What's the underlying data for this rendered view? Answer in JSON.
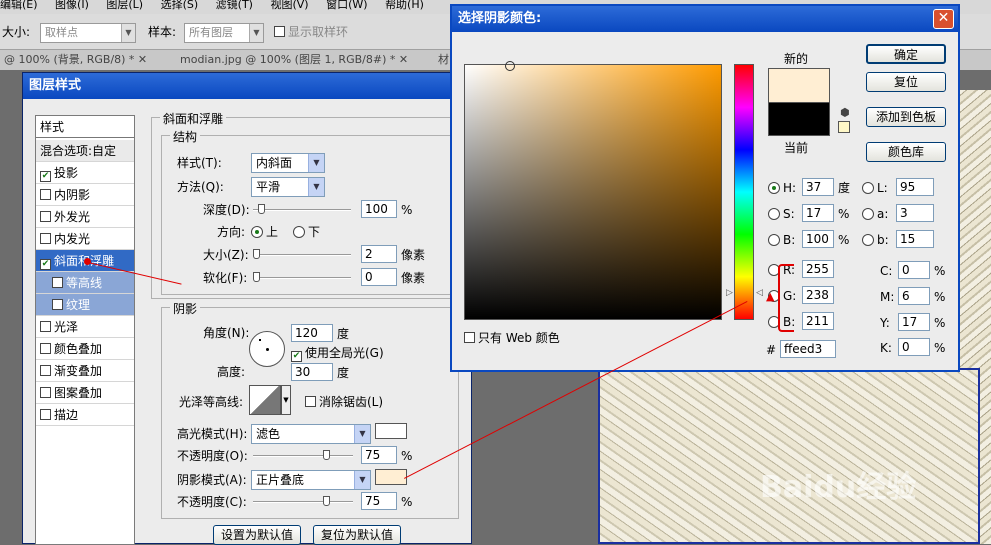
{
  "menubar": {
    "items": [
      "编辑(E)",
      "图像(I)",
      "图层(L)",
      "选择(S)",
      "滤镜(T)",
      "视图(V)",
      "窗口(W)",
      "帮助(H)"
    ]
  },
  "options_bar": {
    "size_label": "大小:",
    "size_value": "取样点",
    "sample_label": "样本:",
    "sample_value": "所有图层",
    "show_ring_label": "显示取样环"
  },
  "document_tabs": [
    {
      "label": "@ 100% (背景, RGB/8) * ✕"
    },
    {
      "label": "modian.jpg @ 100% (图层 1, RGB/8#) * ✕"
    },
    {
      "label": "材"
    }
  ],
  "layer_style": {
    "title": "图层样式",
    "styles_header": "样式",
    "blend_options": "混合选项:自定",
    "items": [
      {
        "label": "投影",
        "checked": true
      },
      {
        "label": "内阴影",
        "checked": false
      },
      {
        "label": "外发光",
        "checked": false
      },
      {
        "label": "内发光",
        "checked": false
      },
      {
        "label": "斜面和浮雕",
        "checked": true,
        "selected": true
      },
      {
        "label": "等高线",
        "checked": false,
        "sub": true
      },
      {
        "label": "纹理",
        "checked": false,
        "sub": true
      },
      {
        "label": "光泽",
        "checked": false
      },
      {
        "label": "颜色叠加",
        "checked": false
      },
      {
        "label": "渐变叠加",
        "checked": false
      },
      {
        "label": "图案叠加",
        "checked": false
      },
      {
        "label": "描边",
        "checked": false
      }
    ],
    "bevel_title": "斜面和浮雕",
    "structure_title": "结构",
    "style_label": "样式(T):",
    "style_value": "内斜面",
    "method_label": "方法(Q):",
    "method_value": "平滑",
    "depth_label": "深度(D):",
    "depth_value": "100",
    "depth_unit": "%",
    "direction_label": "方向:",
    "dir_up": "上",
    "dir_down": "下",
    "size_label": "大小(Z):",
    "size_value": "2",
    "size_unit": "像素",
    "soften_label": "软化(F):",
    "soften_value": "0",
    "soften_unit": "像素",
    "shading_title": "阴影",
    "angle_label": "角度(N):",
    "angle_value": "120",
    "angle_unit": "度",
    "global_light_label": "使用全局光(G)",
    "altitude_label": "高度:",
    "altitude_value": "30",
    "altitude_unit": "度",
    "gloss_label": "光泽等高线:",
    "antialias_label": "消除锯齿(L)",
    "highlight_mode_label": "高光模式(H):",
    "highlight_mode_value": "滤色",
    "highlight_color": "#ffffff",
    "opacity1_label": "不透明度(O):",
    "opacity1_value": "75",
    "opacity_unit": "%",
    "shadow_mode_label": "阴影模式(A):",
    "shadow_mode_value": "正片叠底",
    "shadow_color": "#ffeed3",
    "opacity2_label": "不透明度(C):",
    "opacity2_value": "75",
    "set_default": "设置为默认值",
    "reset_default": "复位为默认值",
    "opacity1_level": 0.75,
    "opacity2_level": 0.75,
    "depth_level": 0.05,
    "size_level": 0.0,
    "soften_level": 0.0
  },
  "color_picker": {
    "title": "选择阴影颜色:",
    "new_label": "新的",
    "current_label": "当前",
    "new_color": "#ffeed3",
    "current_color": "#000000",
    "ok": "确定",
    "reset": "复位",
    "add_swatch": "添加到色板",
    "color_lib": "颜色库",
    "web_only": "只有 Web 颜色",
    "H_label": "H:",
    "H": "37",
    "H_unit": "度",
    "S_label": "S:",
    "S": "17",
    "S_unit": "%",
    "Bv_label": "B:",
    "Bv": "100",
    "Bv_unit": "%",
    "R_label": "R:",
    "R": "255",
    "G_label": "G:",
    "G": "238",
    "B_label": "B:",
    "B": "211",
    "L_label": "L:",
    "L": "95",
    "a_label": "a:",
    "a": "3",
    "b_label": "b:",
    "b": "15",
    "C_label": "C:",
    "C": "0",
    "M_label": "M:",
    "M": "6",
    "Y_label": "Y:",
    "Y": "17",
    "K_label": "K:",
    "K": "0",
    "cmyk_unit": "%",
    "hex_label": "#",
    "hex": "ffeed3"
  },
  "watermark": "Baidu经验"
}
